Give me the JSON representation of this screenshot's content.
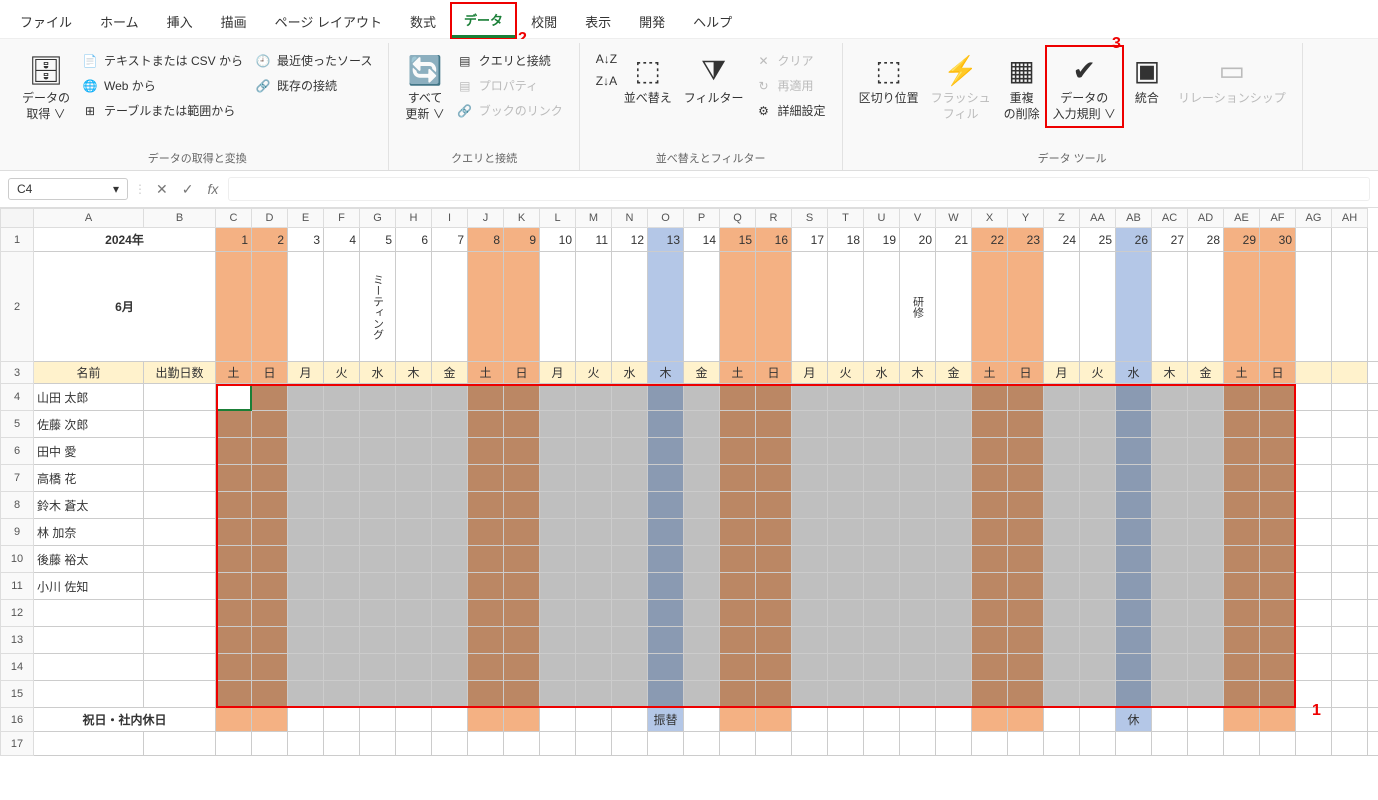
{
  "menu": {
    "tabs": [
      "ファイル",
      "ホーム",
      "挿入",
      "描画",
      "ページ レイアウト",
      "数式",
      "データ",
      "校閲",
      "表示",
      "開発",
      "ヘルプ"
    ],
    "active": "データ"
  },
  "annotations": {
    "one": "1",
    "two": "2",
    "three": "3"
  },
  "ribbon": {
    "g1": {
      "big": "データの\n取得 ∨",
      "items": [
        "テキストまたは CSV から",
        "Web から",
        "テーブルまたは範囲から",
        "最近使ったソース",
        "既存の接続"
      ],
      "label": "データの取得と変換"
    },
    "g2": {
      "big": "すべて\n更新 ∨",
      "items": [
        "クエリと接続",
        "プロパティ",
        "ブックのリンク"
      ],
      "label": "クエリと接続"
    },
    "g3": {
      "sort": "並べ替え",
      "filter": "フィルター",
      "clear": "クリア",
      "reapply": "再適用",
      "adv": "詳細設定",
      "label": "並べ替えとフィルター"
    },
    "g4": {
      "items": [
        "区切り位置",
        "フラッシュ\nフィル",
        "重複\nの削除",
        "データの\n入力規則 ∨",
        "統合",
        "リレーションシップ"
      ],
      "label": "データ ツール"
    }
  },
  "formula": {
    "namebox": "C4",
    "fx": "fx"
  },
  "sheet": {
    "cols": [
      "A",
      "B",
      "C",
      "D",
      "E",
      "F",
      "G",
      "H",
      "I",
      "J",
      "K",
      "L",
      "M",
      "N",
      "O",
      "P",
      "Q",
      "R",
      "S",
      "T",
      "U",
      "V",
      "W",
      "X",
      "Y",
      "Z",
      "AA",
      "AB",
      "AC",
      "AD",
      "AE",
      "AF",
      "AG",
      "AH"
    ],
    "year": "2024年",
    "month": "6月",
    "r2notes": {
      "G": "ミーティング",
      "V": "研修"
    },
    "nameHeader": "名前",
    "daysHeader": "出勤日数",
    "holidayRow": "祝日・社内休日",
    "holidayCells": {
      "O": "振替",
      "AB": "休"
    },
    "days": [
      {
        "col": "C",
        "n": "1",
        "w": "土",
        "cls": "bg-orange"
      },
      {
        "col": "D",
        "n": "2",
        "w": "日",
        "cls": "bg-orange"
      },
      {
        "col": "E",
        "n": "3",
        "w": "月",
        "cls": ""
      },
      {
        "col": "F",
        "n": "4",
        "w": "火",
        "cls": ""
      },
      {
        "col": "G",
        "n": "5",
        "w": "水",
        "cls": ""
      },
      {
        "col": "H",
        "n": "6",
        "w": "木",
        "cls": ""
      },
      {
        "col": "I",
        "n": "7",
        "w": "金",
        "cls": ""
      },
      {
        "col": "J",
        "n": "8",
        "w": "土",
        "cls": "bg-orange"
      },
      {
        "col": "K",
        "n": "9",
        "w": "日",
        "cls": "bg-orange"
      },
      {
        "col": "L",
        "n": "10",
        "w": "月",
        "cls": ""
      },
      {
        "col": "M",
        "n": "11",
        "w": "火",
        "cls": ""
      },
      {
        "col": "N",
        "n": "12",
        "w": "水",
        "cls": ""
      },
      {
        "col": "O",
        "n": "13",
        "w": "木",
        "cls": "bg-blue"
      },
      {
        "col": "P",
        "n": "14",
        "w": "金",
        "cls": ""
      },
      {
        "col": "Q",
        "n": "15",
        "w": "土",
        "cls": "bg-orange"
      },
      {
        "col": "R",
        "n": "16",
        "w": "日",
        "cls": "bg-orange"
      },
      {
        "col": "S",
        "n": "17",
        "w": "月",
        "cls": ""
      },
      {
        "col": "T",
        "n": "18",
        "w": "火",
        "cls": ""
      },
      {
        "col": "U",
        "n": "19",
        "w": "水",
        "cls": ""
      },
      {
        "col": "V",
        "n": "20",
        "w": "木",
        "cls": ""
      },
      {
        "col": "W",
        "n": "21",
        "w": "金",
        "cls": ""
      },
      {
        "col": "X",
        "n": "22",
        "w": "土",
        "cls": "bg-orange"
      },
      {
        "col": "Y",
        "n": "23",
        "w": "日",
        "cls": "bg-orange"
      },
      {
        "col": "Z",
        "n": "24",
        "w": "月",
        "cls": ""
      },
      {
        "col": "AA",
        "n": "25",
        "w": "火",
        "cls": ""
      },
      {
        "col": "AB",
        "n": "26",
        "w": "水",
        "cls": "bg-blue"
      },
      {
        "col": "AC",
        "n": "27",
        "w": "木",
        "cls": ""
      },
      {
        "col": "AD",
        "n": "28",
        "w": "金",
        "cls": ""
      },
      {
        "col": "AE",
        "n": "29",
        "w": "土",
        "cls": "bg-orange"
      },
      {
        "col": "AF",
        "n": "30",
        "w": "日",
        "cls": "bg-orange"
      },
      {
        "col": "AG",
        "n": "",
        "w": "",
        "cls": ""
      },
      {
        "col": "AH",
        "n": "",
        "w": "",
        "cls": ""
      }
    ],
    "names": [
      "山田 太郎",
      "佐藤 次郎",
      "田中 愛",
      "高橋 花",
      "鈴木 蒼太",
      "林 加奈",
      "後藤 裕太",
      "小川 佐知",
      "",
      "",
      "",
      ""
    ]
  }
}
